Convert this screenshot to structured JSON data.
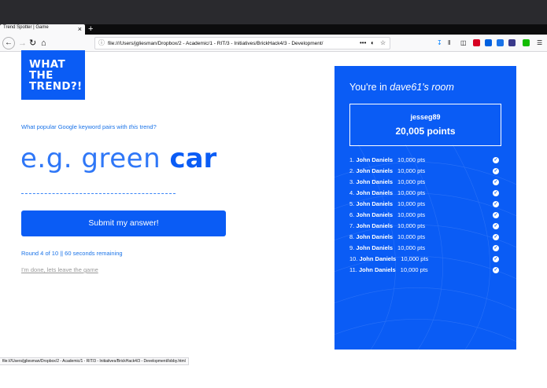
{
  "browser": {
    "tab_title": "Trend Spotter | Game",
    "tab_close": "×",
    "new_tab": "+",
    "url": "file:///Users/jgliesman/Dropbox/2 - Academic/1 - RIT/3 - Initiatives/BrickHack4/3 - Development/",
    "url_more": "•••",
    "status_url": "file:///Users/jgliesman/Dropbox/2 - Academic/1 - RIT/3 - Initiatives/BrickHack4/3 - Development/lobby.html"
  },
  "logo": {
    "line1": "WHAT",
    "line2": "THE",
    "line3": "TREND?!"
  },
  "game": {
    "question_pre": "What popular Google keyword pairs with ",
    "question_em": "this",
    "question_post": " trend?",
    "example_light": "e.g. green ",
    "example_bold": "car",
    "submit_label": "Submit my answer!",
    "round_text": "Round 4 of 10 || 60 seconds remaining",
    "leave_label": "I'm done, lets leave the game"
  },
  "room": {
    "title_pre": "You're in ",
    "title_em": "dave61's room",
    "player_name": "jesseg89",
    "player_points": "20,005 points",
    "leaderboard": [
      {
        "rank": "1.",
        "name": "John Daniels",
        "pts": "10,000 pts"
      },
      {
        "rank": "2.",
        "name": "John Daniels",
        "pts": "10,000 pts"
      },
      {
        "rank": "3.",
        "name": "John Daniels",
        "pts": "10,000 pts"
      },
      {
        "rank": "4.",
        "name": "John Daniels",
        "pts": "10,000 pts"
      },
      {
        "rank": "5.",
        "name": "John Daniels",
        "pts": "10,000 pts"
      },
      {
        "rank": "6.",
        "name": "John Daniels",
        "pts": "10,000 pts"
      },
      {
        "rank": "7.",
        "name": "John Daniels",
        "pts": "10,000 pts"
      },
      {
        "rank": "8.",
        "name": "John Daniels",
        "pts": "10,000 pts"
      },
      {
        "rank": "9.",
        "name": "John Daniels",
        "pts": "10,000 pts"
      },
      {
        "rank": "10.",
        "name": "John Daniels",
        "pts": "10,000 pts"
      },
      {
        "rank": "11.",
        "name": "John Daniels",
        "pts": "10,000 pts"
      }
    ]
  },
  "colors": {
    "brand_blue": "#0a5cf5",
    "link_blue": "#1a73e8",
    "muted_gray": "#9a9a9a"
  }
}
